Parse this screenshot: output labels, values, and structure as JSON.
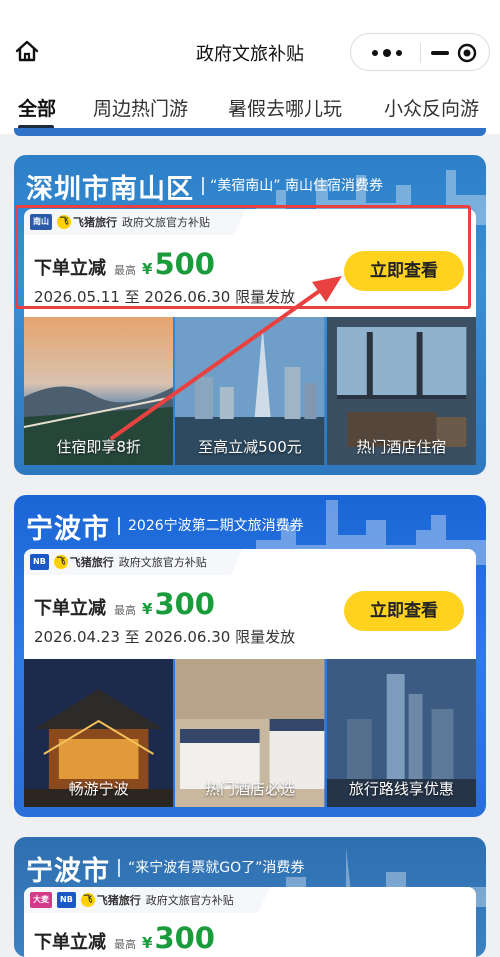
{
  "nav": {
    "title": "政府文旅补贴"
  },
  "tabs": [
    "全部",
    "周边热门游",
    "暑假去哪儿玩",
    "小众反向游"
  ],
  "icons": [
    "home-icon",
    "more-dots-icon",
    "minimize-icon",
    "close-target-icon"
  ],
  "colors": {
    "accent_green": "#1a9c3d",
    "button_yellow": "#ffd21f",
    "highlight_red": "#e8413f"
  },
  "cards": [
    {
      "city": "深圳市南山区",
      "subtitle": "“美宿南山” 南山住宿消费券",
      "tag_text": "政府文旅官方补贴",
      "tag_brand": "飞猪旅行",
      "deal_label": "下单立减",
      "max_label": "最高",
      "currency": "¥",
      "amount": "500",
      "dates": "2026.05.11 至 2026.06.30 限量发放",
      "button": "立即查看",
      "photos": [
        "住宿即享8折",
        "至高立减500元",
        "热门酒店住宿"
      ]
    },
    {
      "city": "宁波市",
      "subtitle": "2026宁波第二期文旅消费券",
      "tag_text": "政府文旅官方补贴",
      "tag_brand": "飞猪旅行",
      "deal_label": "下单立减",
      "max_label": "最高",
      "currency": "¥",
      "amount": "300",
      "dates": "2026.04.23 至 2026.06.30 限量发放",
      "button": "立即查看",
      "photos": [
        "畅游宁波",
        "热门酒店必选",
        "旅行路线享优惠"
      ]
    },
    {
      "city": "宁波市",
      "subtitle": "“来宁波有票就GO了”消费券",
      "tag_text": "政府文旅官方补贴",
      "tag_brand": "飞猪旅行",
      "tag_extra": "大麦",
      "deal_label": "下单立减",
      "max_label": "最高",
      "currency": "¥",
      "amount": "300"
    }
  ]
}
